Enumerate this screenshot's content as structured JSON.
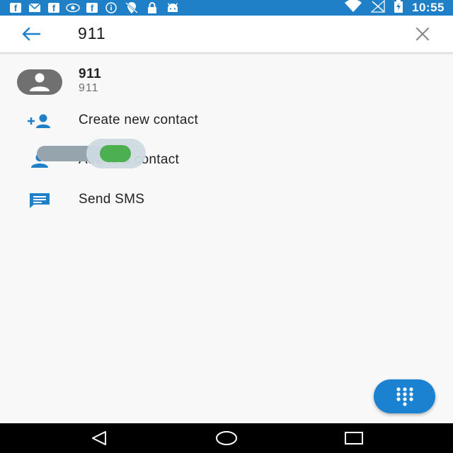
{
  "status_bar": {
    "time": "10:55",
    "left_icons": [
      "facebook-icon",
      "email-icon",
      "facebook-icon",
      "eye-icon",
      "facebook-icon",
      "info-icon",
      "no-location-icon",
      "lock-icon",
      "android-icon"
    ],
    "right_icons": [
      "wifi-icon",
      "no-signal-icon",
      "battery-charging-icon"
    ],
    "fb_letter": "f",
    "color": "#1f7fc7"
  },
  "search": {
    "query": "911"
  },
  "result": {
    "name": "911",
    "number": "911"
  },
  "actions": [
    {
      "label": "Create new contact",
      "icon": "add-contact-icon"
    },
    {
      "label": "Add to a contact",
      "icon": "person-icon"
    },
    {
      "label": "Send SMS",
      "icon": "message-icon"
    }
  ],
  "overlay_toggle": {
    "state": "on",
    "knob_color": "#4caf50"
  },
  "fab": {
    "icon": "dialpad-icon",
    "color": "#1b82d2"
  },
  "nav": {
    "back": "back-icon",
    "home": "home-icon",
    "recents": "recents-icon"
  }
}
